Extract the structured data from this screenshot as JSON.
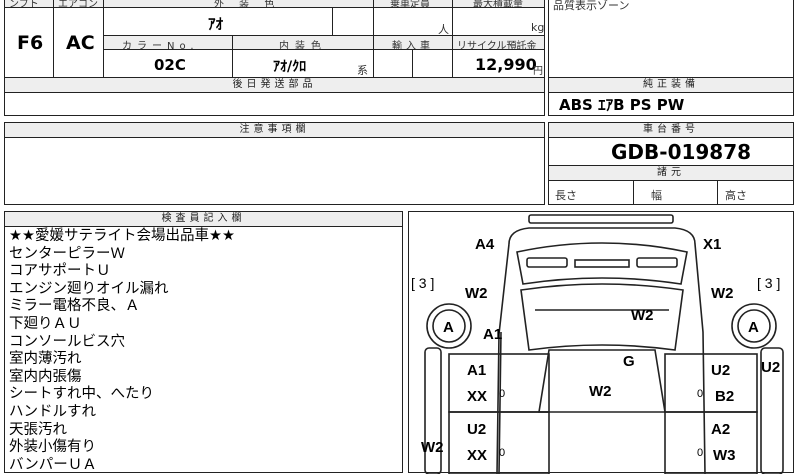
{
  "top": {
    "col_headers": [
      "ンフト",
      "エアコン",
      "外 装 色",
      "乗車定員",
      "最大積載量"
    ],
    "col_header_extra": "品質表示ゾーン",
    "mission": "F6",
    "aircon": "AC",
    "exterior_color": "ｱｵ",
    "capacity_unit": "人",
    "load_unit": "kg",
    "color_no_label": "カラーNo.",
    "interior_label": "内装色",
    "import_label": "輸入車",
    "recycle_label": "リサイクル預託金",
    "color_no": "02C",
    "interior": "ｱｵ/ｸﾛ",
    "interior_suffix": "系",
    "recycle_fee": "12,990",
    "recycle_unit": "円"
  },
  "later_parts": {
    "header": "後日発送部品",
    "value": ""
  },
  "genuine": {
    "header": "純正装備",
    "value": "ABS ｴｱB PS PW"
  },
  "caution": {
    "header": "注意事項欄",
    "value": ""
  },
  "chassis": {
    "header": "車台番号",
    "number": "GDB-019878",
    "dims_header": "諸元",
    "length_label": "長さ",
    "width_label": "幅",
    "height_label": "高さ"
  },
  "inspector": {
    "header": "検査員記入欄",
    "lines": [
      "★★愛媛サテライト会場出品車★★",
      "センターピラーＷ",
      "コアサポートＵ",
      "エンジン廻りオイル漏れ",
      "ミラー電格不良、Ａ",
      "下廻りＡＵ",
      "コンソールビス穴",
      "室内薄汚れ",
      "室内内張傷",
      "シートすれ中、へたり",
      "ハンドルすれ",
      "天張汚れ",
      "外装小傷有り",
      "バンパーＵＡ"
    ]
  },
  "diagram": {
    "marks": {
      "a4": "A4",
      "x1": "X1",
      "bracket_left": "[ 3 ]",
      "bracket_right": "[ 3 ]",
      "w2_left": "W2",
      "w2_right": "W2",
      "a_left": "A",
      "a_right": "A",
      "a1_left": "A1",
      "w2_hood": "W2",
      "g_roof": "G",
      "a1_door": "A1",
      "u2_door": "U2",
      "u2_right_edge": "U2",
      "xx_1": "XX",
      "zero_1": "0",
      "zero_2": "0",
      "b2": "B2",
      "w2_center": "W2",
      "u2_rear": "U2",
      "a2": "A2",
      "xx_2": "XX",
      "zero_3": "0",
      "zero_4": "0",
      "w3": "W3",
      "w2_bottom_left": "W2"
    }
  }
}
